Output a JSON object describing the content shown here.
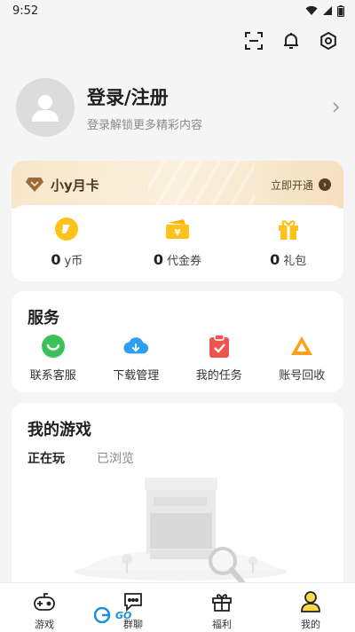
{
  "status_bar": {
    "time": "9:52"
  },
  "profile": {
    "title": "登录/注册",
    "subtitle": "登录解锁更多精彩内容"
  },
  "month_card": {
    "title": "小y月卡",
    "open_label": "立即开通",
    "wallet": [
      {
        "value": "0",
        "unit": "y币",
        "icon": "y-coin-icon"
      },
      {
        "value": "0",
        "unit": "代金券",
        "icon": "voucher-icon"
      },
      {
        "value": "0",
        "unit": "礼包",
        "icon": "gift-icon"
      }
    ]
  },
  "services": {
    "title": "服务",
    "items": [
      {
        "label": "联系客服",
        "icon": "customer-service-icon"
      },
      {
        "label": "下载管理",
        "icon": "download-cloud-icon"
      },
      {
        "label": "我的任务",
        "icon": "task-clipboard-icon"
      },
      {
        "label": "账号回收",
        "icon": "recycle-icon"
      }
    ]
  },
  "games": {
    "title": "我的游戏",
    "tabs": [
      "正在玩",
      "已浏览"
    ]
  },
  "bottom_nav": {
    "items": [
      {
        "label": "游戏",
        "icon": "gamepad-icon"
      },
      {
        "label": "群聊",
        "icon": "chat-bubble-icon"
      },
      {
        "label": "福利",
        "icon": "gift-box-icon"
      },
      {
        "label": "我的",
        "icon": "user-icon"
      }
    ]
  },
  "watermark": {
    "text": "GO"
  },
  "colors": {
    "accent_yellow": "#ffc21a",
    "month_gradient": "#f7e6c8",
    "green": "#3cc15a",
    "blue": "#2f9df0",
    "red": "#ef5350",
    "orange": "#ff9f1a"
  }
}
